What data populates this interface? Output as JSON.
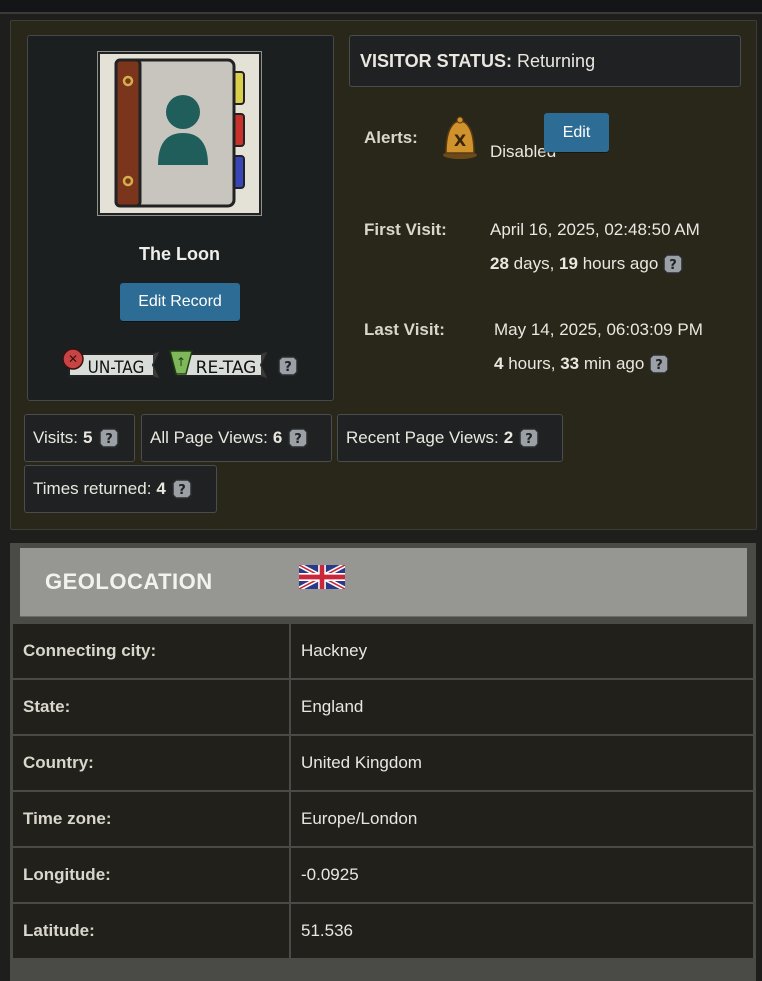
{
  "profile": {
    "name": "The Loon",
    "edit_record_label": "Edit Record",
    "untag_label": "UN-TAG",
    "retag_label": "RE-TAG"
  },
  "status": {
    "label": "VISITOR STATUS:",
    "value": "Returning"
  },
  "alerts": {
    "label": "Alerts:",
    "value": "Disabled",
    "edit_label": "Edit",
    "icon": "bell-disabled-icon"
  },
  "first_visit": {
    "label": "First Visit:",
    "datetime": "April 16, 2025, 02:48:50 AM",
    "ago_days": "28",
    "ago_days_unit": "days,",
    "ago_hours": "19",
    "ago_hours_unit": "hours ago"
  },
  "last_visit": {
    "label": "Last Visit:",
    "datetime": "May 14, 2025, 06:03:09 PM",
    "ago_hours": "4",
    "ago_hours_unit": "hours,",
    "ago_min": "33",
    "ago_min_unit": "min ago"
  },
  "stats": [
    {
      "label": "Visits:",
      "value": "5"
    },
    {
      "label": "All Page Views:",
      "value": "6"
    },
    {
      "label": "Recent Page Views:",
      "value": "2"
    },
    {
      "label": "Times returned:",
      "value": "4"
    }
  ],
  "geolocation": {
    "title": "GEOLOCATION",
    "flag": "uk-flag",
    "rows": [
      {
        "key": "Connecting city:",
        "value": "Hackney"
      },
      {
        "key": "State:",
        "value": "England"
      },
      {
        "key": "Country:",
        "value": "United Kingdom"
      },
      {
        "key": "Time zone:",
        "value": "Europe/London"
      },
      {
        "key": "Longitude:",
        "value": "-0.0925"
      },
      {
        "key": "Latitude:",
        "value": "51.536"
      }
    ]
  },
  "colors": {
    "button": "#2d6c95",
    "panel": "#29261a",
    "card": "#1c1f20"
  }
}
